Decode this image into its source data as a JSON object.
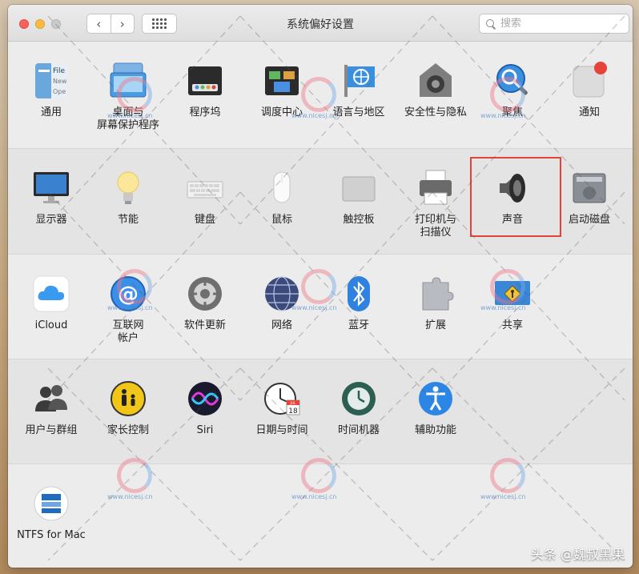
{
  "window": {
    "title": "系统偏好设置",
    "search_placeholder": "搜索"
  },
  "toolbar": {
    "back": "‹",
    "forward": "›"
  },
  "sections": [
    {
      "items": [
        {
          "label": "通用",
          "icon": "general-icon"
        },
        {
          "label": "桌面与\n屏幕保护程序",
          "icon": "desktop-screensaver-icon"
        },
        {
          "label": "程序坞",
          "icon": "dock-icon"
        },
        {
          "label": "调度中心",
          "icon": "mission-control-icon"
        },
        {
          "label": "语言与地区",
          "icon": "language-region-icon"
        },
        {
          "label": "安全性与隐私",
          "icon": "security-privacy-icon"
        },
        {
          "label": "聚焦",
          "icon": "spotlight-icon"
        },
        {
          "label": "通知",
          "icon": "notifications-icon"
        }
      ]
    },
    {
      "items": [
        {
          "label": "显示器",
          "icon": "displays-icon"
        },
        {
          "label": "节能",
          "icon": "energy-saver-icon"
        },
        {
          "label": "键盘",
          "icon": "keyboard-icon"
        },
        {
          "label": "鼠标",
          "icon": "mouse-icon"
        },
        {
          "label": "触控板",
          "icon": "trackpad-icon"
        },
        {
          "label": "打印机与\n扫描仪",
          "icon": "printers-scanners-icon"
        },
        {
          "label": "声音",
          "icon": "sound-icon"
        },
        {
          "label": "启动磁盘",
          "icon": "startup-disk-icon"
        }
      ]
    },
    {
      "items": [
        {
          "label": "iCloud",
          "icon": "icloud-icon"
        },
        {
          "label": "互联网\n帐户",
          "icon": "internet-accounts-icon"
        },
        {
          "label": "软件更新",
          "icon": "software-update-icon"
        },
        {
          "label": "网络",
          "icon": "network-icon"
        },
        {
          "label": "蓝牙",
          "icon": "bluetooth-icon"
        },
        {
          "label": "扩展",
          "icon": "extensions-icon"
        },
        {
          "label": "共享",
          "icon": "sharing-icon"
        }
      ]
    },
    {
      "items": [
        {
          "label": "用户与群组",
          "icon": "users-groups-icon"
        },
        {
          "label": "家长控制",
          "icon": "parental-controls-icon"
        },
        {
          "label": "Siri",
          "icon": "siri-icon"
        },
        {
          "label": "日期与时间",
          "icon": "date-time-icon"
        },
        {
          "label": "时间机器",
          "icon": "time-machine-icon"
        },
        {
          "label": "辅助功能",
          "icon": "accessibility-icon"
        }
      ]
    },
    {
      "items": [
        {
          "label": "NTFS for Mac",
          "icon": "ntfs-for-mac-icon"
        }
      ]
    }
  ],
  "clock_badge": {
    "month": "JUL",
    "day": "18"
  },
  "watermark": {
    "site": "www.nicesj.cn",
    "footer": "头条 @魏叔黑果"
  },
  "colors": {
    "highlight": "#e0443a"
  }
}
